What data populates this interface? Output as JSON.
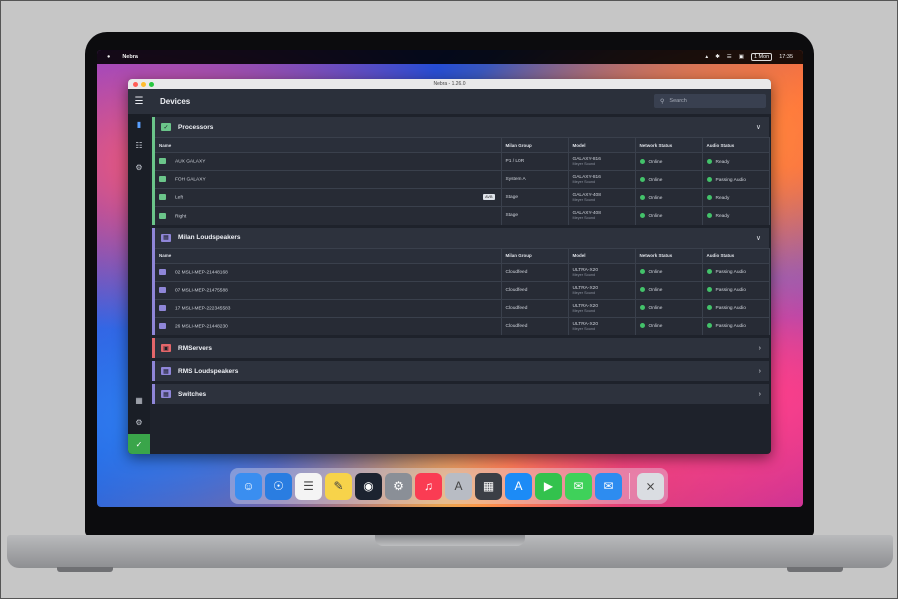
{
  "menubar": {
    "app_name": "Nebra",
    "right_items": [
      "▴",
      "✱",
      "☰",
      "▣"
    ],
    "clock_box": "1 Mon",
    "time": "17:35"
  },
  "window": {
    "title": "Nebra - 1.26.0"
  },
  "header": {
    "title": "Devices",
    "search_placeholder": "Search"
  },
  "sidebar": {
    "items": [
      {
        "name": "devices",
        "icon": "bar-chart-icon"
      },
      {
        "name": "hierarchy",
        "icon": "hierarchy-icon"
      },
      {
        "name": "settings",
        "icon": "gear-icon"
      },
      {
        "name": "calendar",
        "icon": "calendar-icon"
      },
      {
        "name": "preferences",
        "icon": "gear-icon"
      },
      {
        "name": "status",
        "icon": "check-icon"
      }
    ]
  },
  "columns": {
    "name": "Name",
    "group": "Milan Group",
    "model": "Model",
    "network": "Network Status",
    "audio": "Audio Status"
  },
  "sections": {
    "processors": {
      "title": "Processors",
      "rows": [
        {
          "name": "AUX GALAXY",
          "group": "P1 / L0R",
          "model": "GALAXY-816",
          "vendor": "Meyer Sound",
          "network": "Online",
          "audio": "Ready",
          "badge": ""
        },
        {
          "name": "FOH GALAXY",
          "group": "System A",
          "model": "GALAXY-816",
          "vendor": "Meyer Sound",
          "network": "Online",
          "audio": "Passing Audio",
          "badge": ""
        },
        {
          "name": "Left",
          "group": "Stage",
          "model": "GALAXY-408",
          "vendor": "Meyer Sound",
          "network": "Online",
          "audio": "Ready",
          "badge": "AVB"
        },
        {
          "name": "Right",
          "group": "Stage",
          "model": "GALAXY-408",
          "vendor": "Meyer Sound",
          "network": "Online",
          "audio": "Ready",
          "badge": ""
        }
      ]
    },
    "milan": {
      "title": "Milan Loudspeakers",
      "rows": [
        {
          "name": "02 MSLI-MEP-21448168",
          "group": "Cloudfeed",
          "model": "ULTRA-X20",
          "vendor": "Meyer Sound",
          "network": "Online",
          "audio": "Passing Audio"
        },
        {
          "name": "07 MSLI-MEP-21475588",
          "group": "Cloudfeed",
          "model": "ULTRA-X20",
          "vendor": "Meyer Sound",
          "network": "Online",
          "audio": "Passing Audio"
        },
        {
          "name": "17 MSLI-MEP-222345583",
          "group": "Cloudfeed",
          "model": "ULTRA-X20",
          "vendor": "Meyer Sound",
          "network": "Online",
          "audio": "Passing Audio"
        },
        {
          "name": "26 MSLI-MEP-21448230",
          "group": "Cloudfeed",
          "model": "ULTRA-X20",
          "vendor": "Meyer Sound",
          "network": "Online",
          "audio": "Passing Audio"
        }
      ]
    },
    "rmservers": {
      "title": "RMServers"
    },
    "rms_loudspeakers": {
      "title": "RMS Loudspeakers"
    },
    "switches": {
      "title": "Switches"
    }
  },
  "dock": [
    {
      "name": "finder",
      "color": "#3a8ef0",
      "glyph": "☺"
    },
    {
      "name": "safari",
      "color": "#2a7de1",
      "glyph": "☉"
    },
    {
      "name": "reminders",
      "color": "#f4f4f4",
      "glyph": "☰"
    },
    {
      "name": "notes",
      "color": "#f7d34a",
      "glyph": "✎"
    },
    {
      "name": "nebra",
      "color": "#1c2330",
      "glyph": "◉"
    },
    {
      "name": "system-settings",
      "color": "#8a8f97",
      "glyph": "⚙"
    },
    {
      "name": "music",
      "color": "#fa3c53",
      "glyph": "♫"
    },
    {
      "name": "font-book",
      "color": "#b8bcc4",
      "glyph": "A"
    },
    {
      "name": "calculator",
      "color": "#3b3f46",
      "glyph": "▦"
    },
    {
      "name": "app-store",
      "color": "#1c8bf6",
      "glyph": "A"
    },
    {
      "name": "facetime",
      "color": "#33c24d",
      "glyph": "▶"
    },
    {
      "name": "messages",
      "color": "#3fd15a",
      "glyph": "✉"
    },
    {
      "name": "mail",
      "color": "#2d8cf0",
      "glyph": "✉"
    },
    {
      "name": "trash",
      "color": "#dadde2",
      "glyph": "⨯"
    }
  ]
}
